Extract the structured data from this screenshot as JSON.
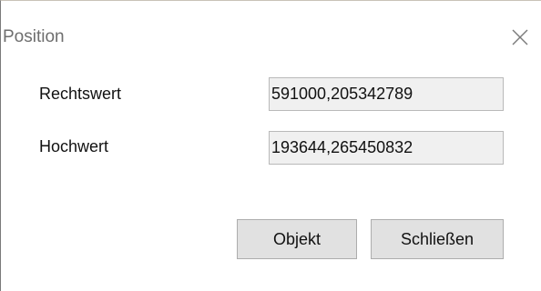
{
  "window": {
    "title": "Position",
    "close_icon": "close-icon"
  },
  "fields": {
    "rechtswert": {
      "label": "Rechtswert",
      "value": "591000,205342789"
    },
    "hochwert": {
      "label": "Hochwert",
      "value": "193644,265450832"
    }
  },
  "buttons": {
    "objekt_label": "Objekt",
    "close_label": "Schließen"
  }
}
